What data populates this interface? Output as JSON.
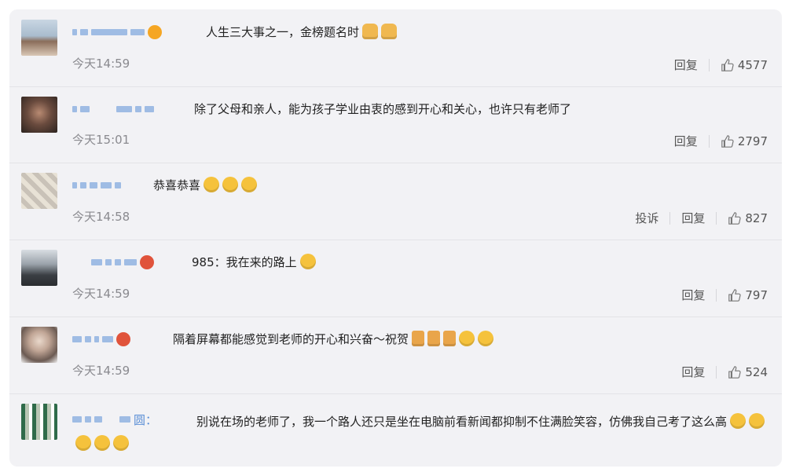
{
  "comments": [
    {
      "text": "人生三大事之一，金榜题名时",
      "time": "今天14:59",
      "actions": [
        "回复"
      ],
      "likes": "4577"
    },
    {
      "text": "除了父母和亲人，能为孩子学业由衷的感到开心和关心，也许只有老师了",
      "time": "今天15:01",
      "actions": [
        "回复"
      ],
      "likes": "2797"
    },
    {
      "text": "恭喜恭喜",
      "time": "今天14:58",
      "actions": [
        "投诉",
        "回复"
      ],
      "likes": "827"
    },
    {
      "text": "985：我在来的路上",
      "time": "今天14:59",
      "actions": [
        "回复"
      ],
      "likes": "797"
    },
    {
      "text": "隔着屏幕都能感觉到老师的开心和兴奋～祝贺",
      "time": "今天14:59",
      "actions": [
        "回复"
      ],
      "likes": "524"
    },
    {
      "name_suffix": "圆：",
      "text": "别说在场的老师了，我一个路人还只是坐在电脑前看新闻都抑制不住满脸笑容，仿佛我自己考了这么高"
    }
  ],
  "colors": {
    "panel_bg": "#f2f2f5",
    "name_blue": "#5b8fd6",
    "time_gray": "#8a8a8f",
    "divider": "#e3e3e7"
  }
}
